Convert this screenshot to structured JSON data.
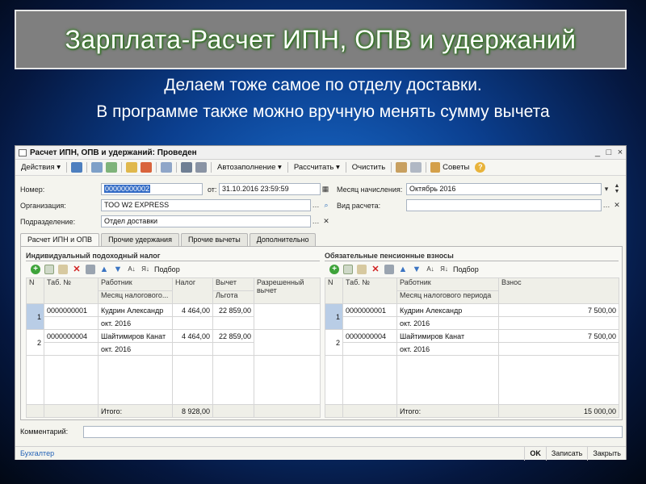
{
  "slide": {
    "title": "Зарплата-Расчет ИПН, ОПВ и удержаний",
    "subtitle_line1": "Делаем тоже самое по отделу доставки.",
    "subtitle_line2": "В программе также можно вручную менять сумму вычета"
  },
  "window": {
    "title": "Расчет ИПН, ОПВ и удержаний: Проведен",
    "controls": [
      "_",
      "□",
      "×"
    ]
  },
  "toolbar": {
    "actions": "Действия ▾",
    "autofill": "Автозаполнение ▾",
    "calculate": "Рассчитать ▾",
    "clear": "Очистить",
    "tips": "Советы"
  },
  "form": {
    "number_label": "Номер:",
    "number_value": "00000000002",
    "date_label": "от:",
    "date_value": "31.10.2016 23:59:59",
    "accrual_month_label": "Месяц начисления:",
    "accrual_month_value": "Октябрь 2016",
    "organization_label": "Организация:",
    "organization_value": "ТОО W2 EXPRESS",
    "calc_type_label": "Вид расчета:",
    "calc_type_value": "",
    "department_label": "Подразделение:",
    "department_value": "Отдел доставки"
  },
  "tabs": [
    "Расчет ИПН и ОПВ",
    "Прочие удержания",
    "Прочие вычеты",
    "Дополнительно"
  ],
  "ipn": {
    "title": "Индивидуальный подоходный налог",
    "selection": "Подбор",
    "headers": {
      "n": "N",
      "tab": "Таб. №",
      "worker": "Работник",
      "month": "Месяц налогового...",
      "tax": "Налог",
      "deduction": "Вычет",
      "benefit": "Льгота",
      "allowed": "Разрешенный",
      "allowed2": "вычет"
    },
    "rows": [
      {
        "n": "1",
        "tab": "0000000001",
        "worker": "Кудрин Александр",
        "month": "окт. 2016",
        "tax": "4 464,00",
        "deduction": "22 859,00"
      },
      {
        "n": "2",
        "tab": "0000000004",
        "worker": "Шайтимиров Канат",
        "month": "окт. 2016",
        "tax": "4 464,00",
        "deduction": "22 859,00"
      }
    ],
    "total_label": "Итого:",
    "total_tax": "8 928,00"
  },
  "opv": {
    "title": "Обязательные пенсионные взносы",
    "selection": "Подбор",
    "headers": {
      "n": "N",
      "tab": "Таб. №",
      "worker": "Работник",
      "month": "Месяц налогового периода",
      "contribution": "Взнос"
    },
    "rows": [
      {
        "n": "1",
        "tab": "0000000001",
        "worker": "Кудрин Александр",
        "month": "окт. 2016",
        "contribution": "7 500,00"
      },
      {
        "n": "2",
        "tab": "0000000004",
        "worker": "Шайтимиров Канат",
        "month": "окт. 2016",
        "contribution": "7 500,00"
      }
    ],
    "total_label": "Итого:",
    "total_contribution": "15 000,00"
  },
  "comment_label": "Комментарий:",
  "statusbar": {
    "user": "Бухгалтер",
    "ok": "OK",
    "save": "Записать",
    "close": "Закрыть"
  }
}
